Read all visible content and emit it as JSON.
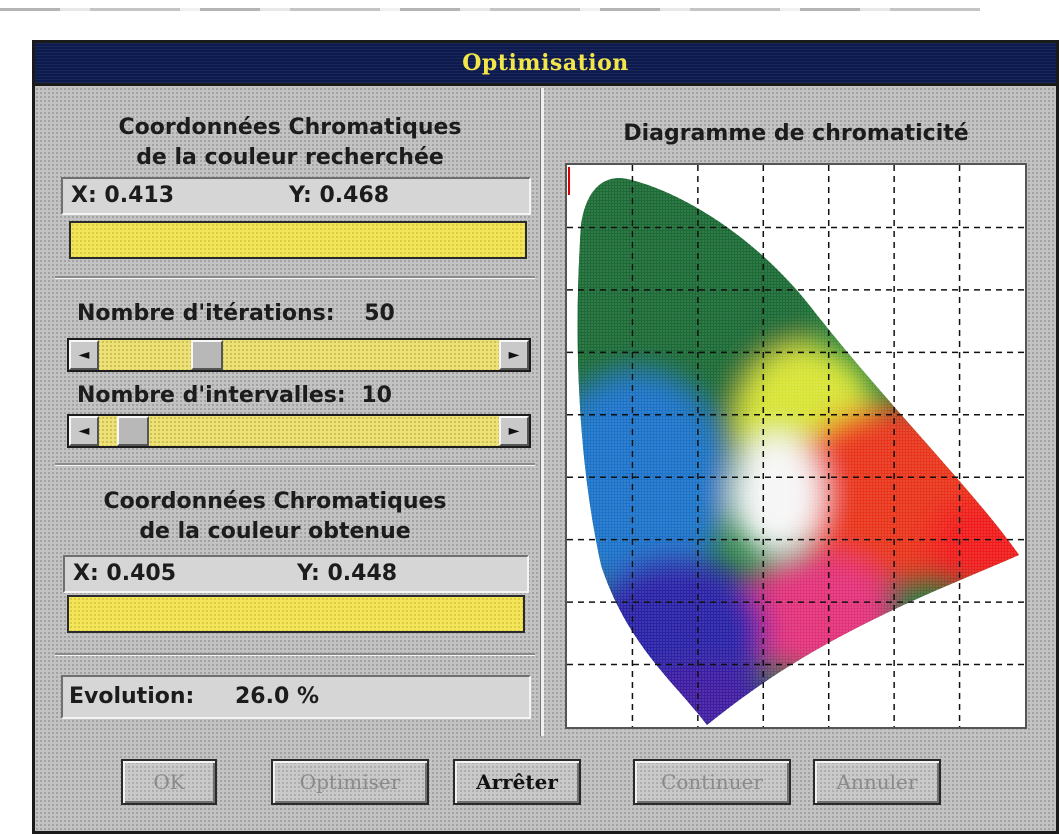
{
  "window": {
    "title": "Optimisation"
  },
  "target": {
    "heading_line1": "Coordonnées Chromatiques",
    "heading_line2": "de la couleur recherchée",
    "x_label": "X: 0.413",
    "y_label": "Y: 0.468",
    "swatch_color": "#f2e55a"
  },
  "iterations": {
    "label": "Nombre d'itérations:",
    "value": "50",
    "slider_fraction": 0.25
  },
  "intervals": {
    "label": "Nombre d'intervalles:",
    "value": "10",
    "slider_fraction": 0.05
  },
  "obtained": {
    "heading_line1": "Coordonnées Chromatiques",
    "heading_line2": "de la couleur obtenue",
    "x_label": "X: 0.405",
    "y_label": "Y: 0.448",
    "swatch_color": "#f2e55a"
  },
  "evolution": {
    "label": "Evolution:",
    "value": "26.0 %"
  },
  "diagram": {
    "title": "Diagramme de chromaticité",
    "grid": true
  },
  "buttons": {
    "ok": "OK",
    "optimiser": "Optimiser",
    "arreter": "Arrêter",
    "continuer": "Continuer",
    "annuler": "Annuler"
  },
  "icons": {
    "scroll_left": "left-arrow-icon",
    "scroll_right": "right-arrow-icon"
  },
  "colors": {
    "title_bar": "#0c1a4e",
    "title_text": "#f2e64a",
    "swatch": "#f2e55a"
  }
}
